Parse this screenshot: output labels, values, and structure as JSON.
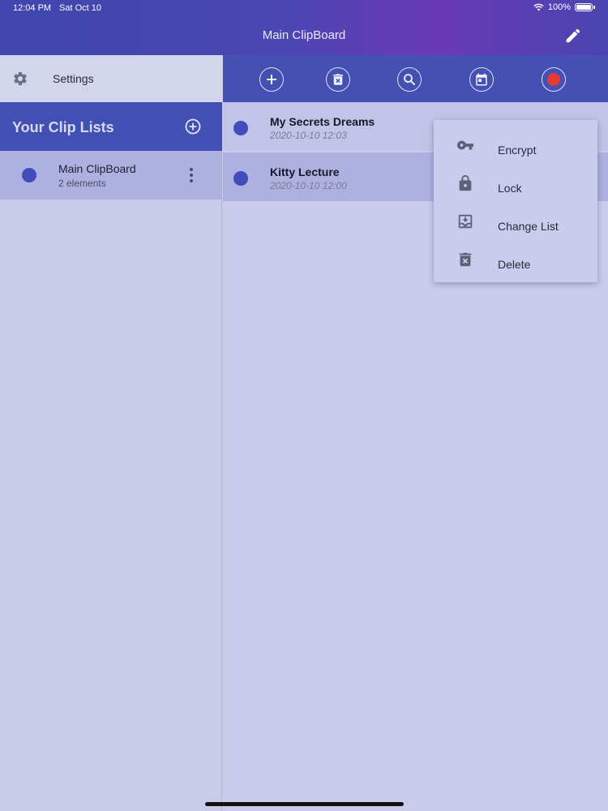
{
  "status_bar": {
    "time": "12:04 PM",
    "date": "Sat Oct 10",
    "battery": "100%"
  },
  "header": {
    "title": "Main ClipBoard",
    "edit_icon": "pencil-icon"
  },
  "sidebar": {
    "settings_label": "Settings",
    "settings_icon": "gear-icon",
    "cliplists_title": "Your Clip Lists",
    "add_list_icon": "plus-circle-icon",
    "lists": [
      {
        "name": "Main ClipBoard",
        "count": "2 elements",
        "dot_color": "#3f4ebc"
      }
    ]
  },
  "toolbar": {
    "buttons": [
      "plus-icon",
      "delete-icon",
      "search-icon",
      "calendar-icon",
      "record-icon"
    ],
    "record_color": "#e53935"
  },
  "clips": [
    {
      "title": "My Secrets Dreams",
      "date": "2020-10-10 12:03"
    },
    {
      "title": "Kitty Lecture",
      "date": "2020-10-10 12:00"
    }
  ],
  "context_menu": {
    "items": [
      {
        "label": "Encrypt",
        "icon": "key-icon"
      },
      {
        "label": "Lock",
        "icon": "lock-icon"
      },
      {
        "label": "Change List",
        "icon": "move-to-list-icon"
      },
      {
        "label": "Delete",
        "icon": "delete-icon"
      }
    ]
  },
  "colors": {
    "header_start": "#3f46ad",
    "header_accent": "#6a3ab6",
    "primary_blue": "#4451b3",
    "dot_blue": "#3f4ebc",
    "background": "#c9c9ea"
  }
}
